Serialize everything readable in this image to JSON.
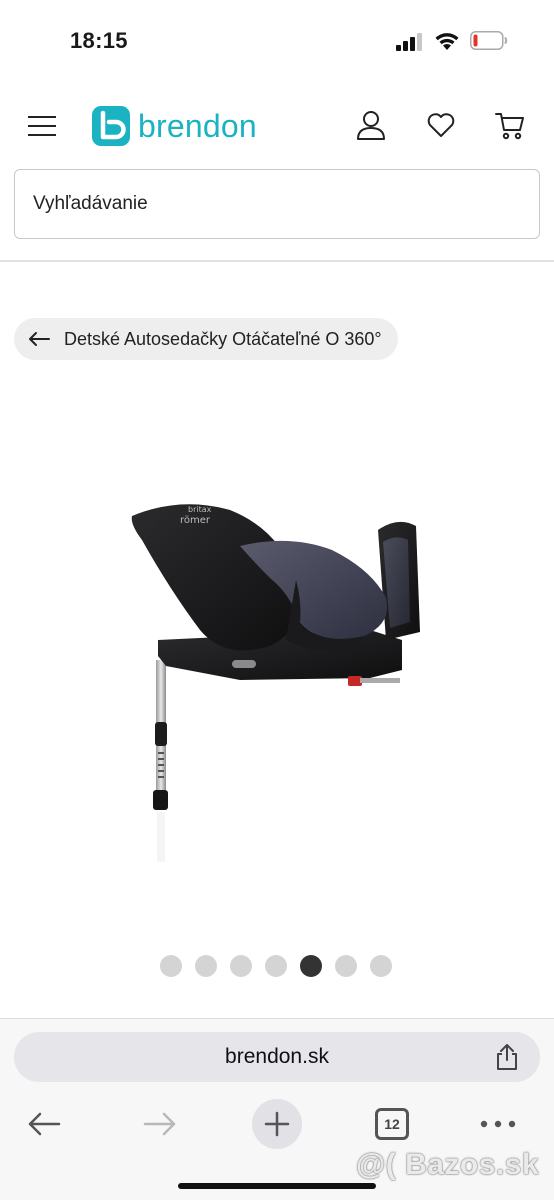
{
  "status_bar": {
    "time": "18:15"
  },
  "header": {
    "logo_text": "brendon",
    "icons": [
      "menu-icon",
      "user-icon",
      "heart-icon",
      "cart-icon"
    ],
    "accent_color": "#1bb3c2"
  },
  "search": {
    "placeholder": "Vyhľadávanie"
  },
  "breadcrumb": {
    "label": "Detské Autosedačky Otáčateľné O 360°"
  },
  "product": {
    "image_text": {
      "brand_top": "britax",
      "brand_bottom": "römer"
    }
  },
  "gallery": {
    "total": 7,
    "active_index": 5
  },
  "browser": {
    "url": "brendon.sk",
    "tab_count": "12"
  },
  "watermark": "@( Bazos.sk"
}
